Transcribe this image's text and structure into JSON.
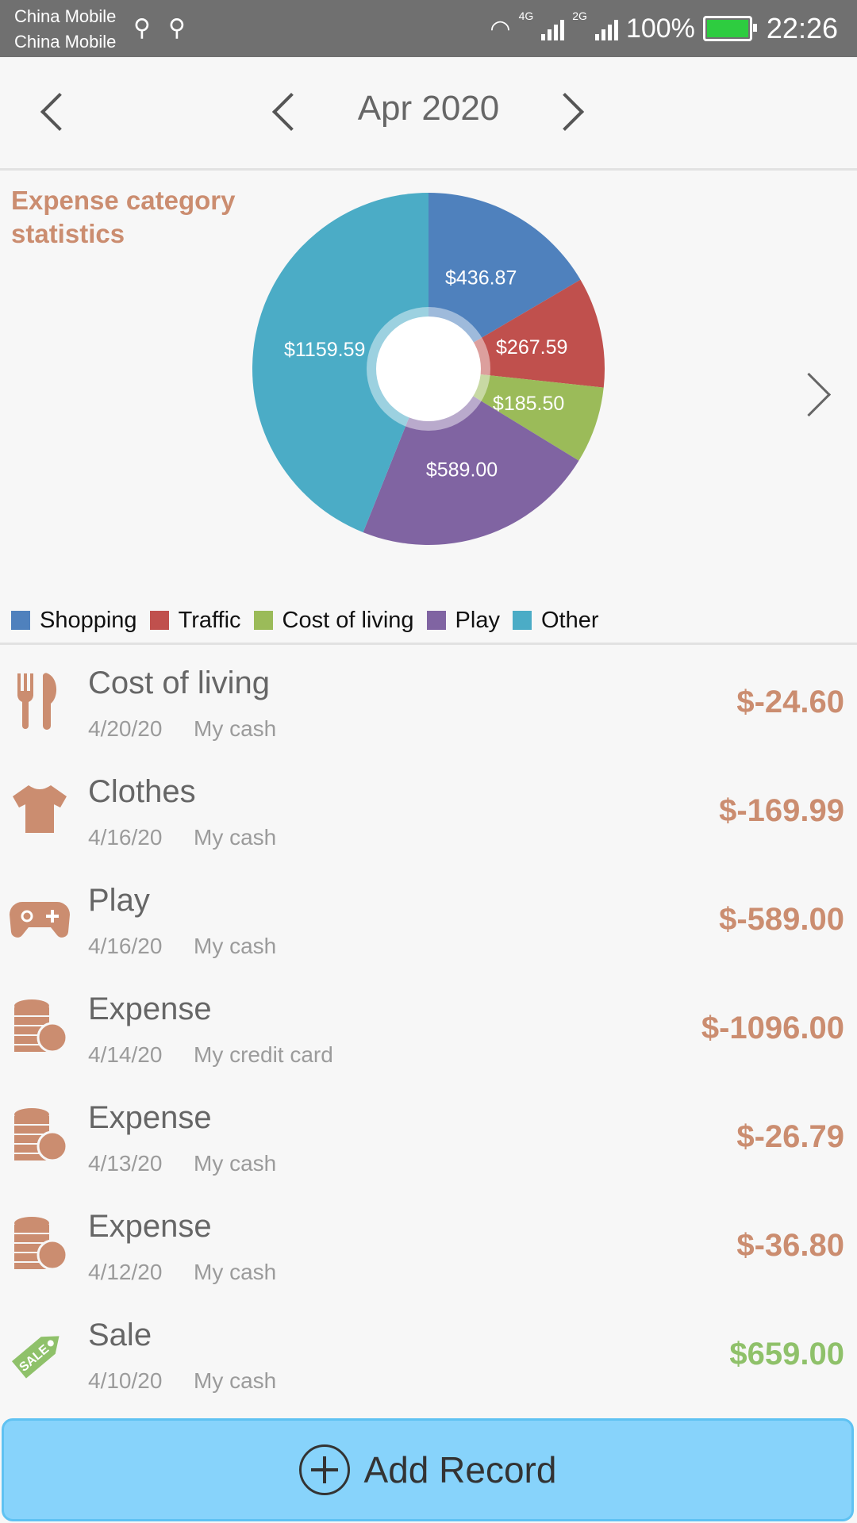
{
  "status": {
    "carrier1": "China Mobile",
    "carrier2": "China Mobile",
    "net1": "4G",
    "net2": "2G",
    "battery": "100%",
    "time": "22:26"
  },
  "header": {
    "month": "Apr 2020"
  },
  "chart_data": {
    "type": "pie",
    "title": "Expense category statistics",
    "categories": [
      "Shopping",
      "Traffic",
      "Cost of living",
      "Play",
      "Other"
    ],
    "values": [
      436.87,
      267.59,
      185.5,
      589.0,
      1159.59
    ],
    "labels": [
      "$436.87",
      "$267.59",
      "$185.50",
      "$589.00",
      "$1159.59"
    ],
    "colors": [
      "#4f81bd",
      "#c0504d",
      "#9bbb59",
      "#8064a2",
      "#4bacc6"
    ],
    "legend": "bottom"
  },
  "records": [
    {
      "name": "Cost of living",
      "date": "4/20/20",
      "account": "My cash",
      "amount": "$-24.60",
      "color": "#cb8d70",
      "icon": "fork-knife-icon"
    },
    {
      "name": "Clothes",
      "date": "4/16/20",
      "account": "My cash",
      "amount": "$-169.99",
      "color": "#cb8d70",
      "icon": "shirt-icon"
    },
    {
      "name": "Play",
      "date": "4/16/20",
      "account": "My cash",
      "amount": "$-589.00",
      "color": "#cb8d70",
      "icon": "gamepad-icon"
    },
    {
      "name": "Expense",
      "date": "4/14/20",
      "account": "My credit card",
      "amount": "$-1096.00",
      "color": "#cb8d70",
      "icon": "coins-icon"
    },
    {
      "name": "Expense",
      "date": "4/13/20",
      "account": "My cash",
      "amount": "$-26.79",
      "color": "#cb8d70",
      "icon": "coins-icon"
    },
    {
      "name": "Expense",
      "date": "4/12/20",
      "account": "My cash",
      "amount": "$-36.80",
      "color": "#cb8d70",
      "icon": "coins-icon"
    },
    {
      "name": "Sale",
      "date": "4/10/20",
      "account": "My cash",
      "amount": "$659.00",
      "color": "#8fc16a",
      "icon": "sale-tag-icon"
    }
  ],
  "sale_tag_text": "SALE",
  "add_button": {
    "label": "Add Record"
  }
}
